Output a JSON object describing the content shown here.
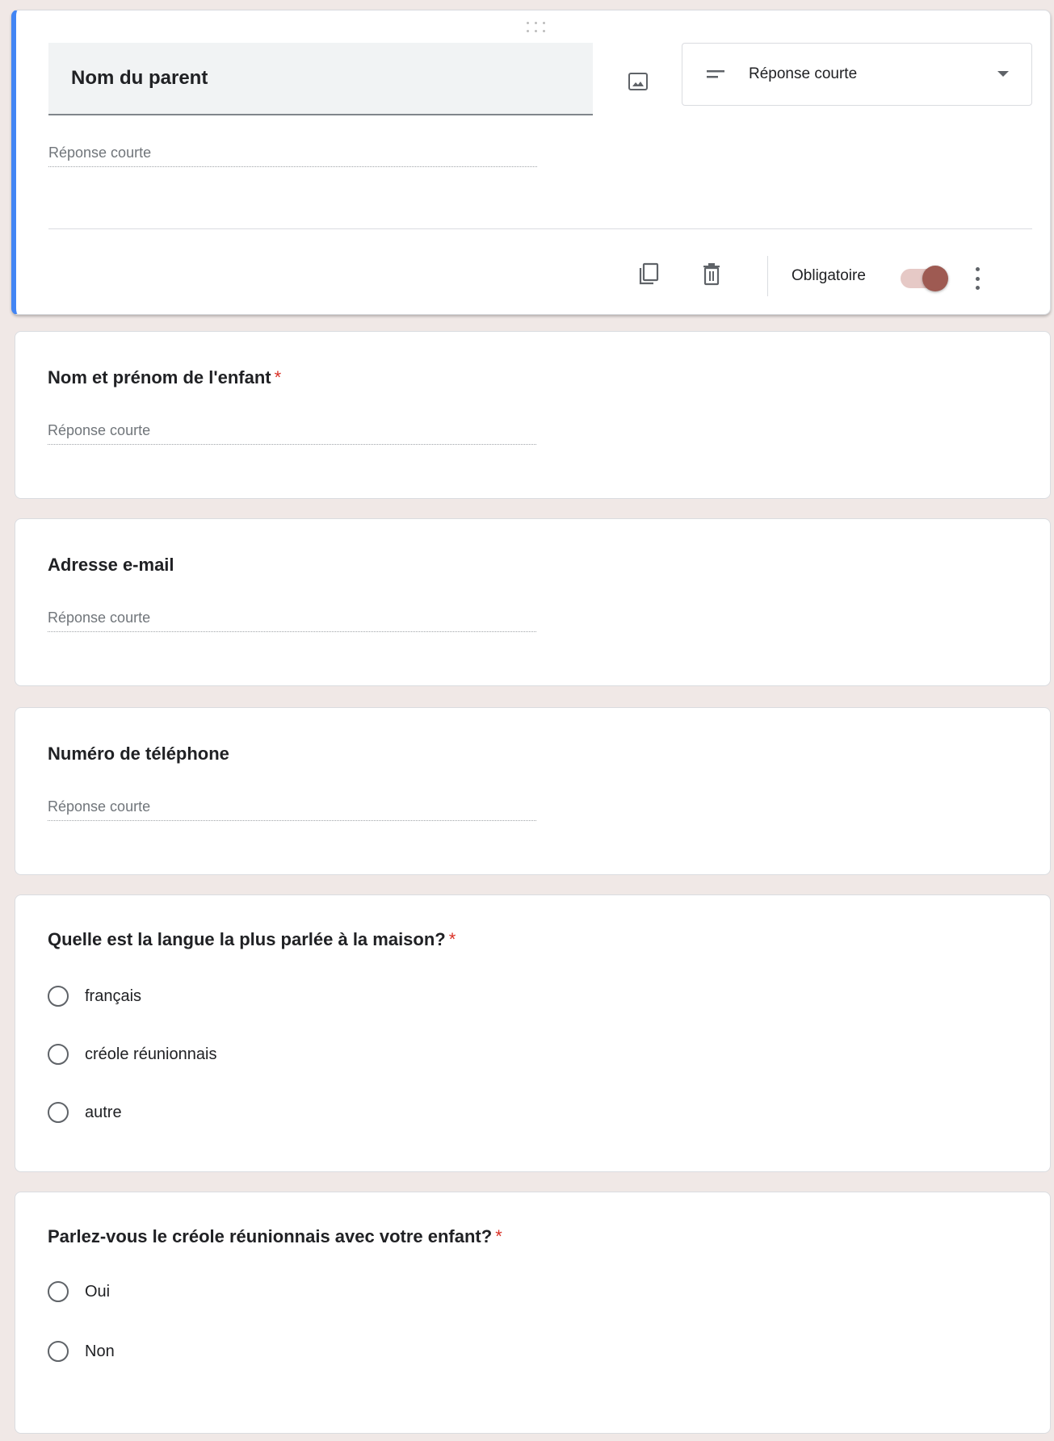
{
  "active_question": {
    "title": "Nom du parent",
    "type_label": "Réponse courte",
    "answer_placeholder": "Réponse courte",
    "required_label": "Obligatoire",
    "required_on": true,
    "accent_color": "#4285f4",
    "toggle_color": "#9e5a52"
  },
  "questions": [
    {
      "title": "Nom et prénom de l'enfant",
      "required": "*",
      "placeholder": "Réponse courte"
    },
    {
      "title": "Adresse e-mail",
      "placeholder": "Réponse courte"
    },
    {
      "title": "Numéro de téléphone",
      "placeholder": "Réponse courte"
    },
    {
      "title": "Quelle est la langue la plus parlée  à la maison?",
      "required": "*",
      "options": [
        "français",
        "créole réunionnais",
        "autre"
      ]
    },
    {
      "title": "Parlez-vous le créole réunionnais avec votre enfant?",
      "required": "*",
      "options": [
        "Oui",
        "Non"
      ]
    }
  ],
  "icons": {
    "drag": "drag-handle-icon",
    "image": "image-icon",
    "short_answer": "short-text-icon",
    "dropdown": "chevron-down-icon",
    "copy": "copy-icon",
    "delete": "trash-icon",
    "more": "more-vert-icon"
  }
}
